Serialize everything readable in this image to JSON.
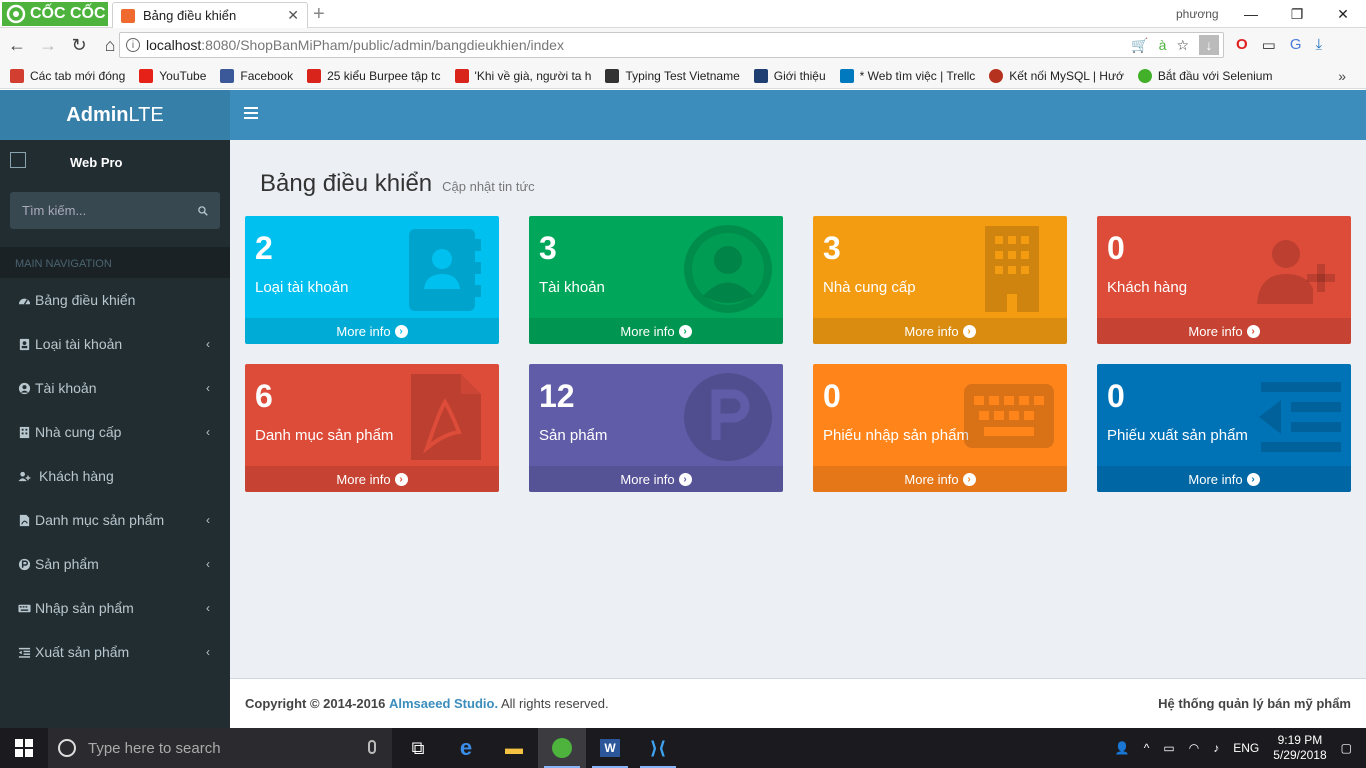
{
  "browser": {
    "brand": "CỐC CỐC",
    "tab_title": "Bảng điều khiển",
    "profile": "phương",
    "url_host": "localhost",
    "url_path": ":8080/ShopBanMiPham/public/admin/bangdieukhien/index",
    "bookmarks": [
      {
        "label": "Các tab mới đóng",
        "color": "#d23f31"
      },
      {
        "label": "YouTube",
        "color": "#e62117"
      },
      {
        "label": "Facebook",
        "color": "#3b5998"
      },
      {
        "label": "25 kiểu Burpee tập tc",
        "color": "#d9241b"
      },
      {
        "label": "'Khi về già, người ta h",
        "color": "#d9241b"
      },
      {
        "label": "Typing Test Vietname",
        "color": "#333333"
      },
      {
        "label": "Giới thiệu",
        "color": "#1f3f73"
      },
      {
        "label": "* Web tìm việc | Trellc",
        "color": "#0079bf"
      },
      {
        "label": "Kết nối MySQL | Hướ",
        "color": "#b5321e"
      },
      {
        "label": "Bắt đầu với Selenium",
        "color": "#43b02a"
      }
    ]
  },
  "admin": {
    "logo_bold": "Admin",
    "logo_light": "LTE",
    "user_name": "Web Pro",
    "user_img_alt": "User Image",
    "search_placeholder": "Tìm kiếm...",
    "nav_header": "MAIN NAVIGATION",
    "menu": [
      {
        "label": "Bảng điều khiển",
        "icon": "dashboard-icon",
        "caret": ""
      },
      {
        "label": "Loại tài khoản",
        "icon": "contact-card-icon",
        "caret": "‹"
      },
      {
        "label": "Tài khoản",
        "icon": "user-circle-icon",
        "caret": "‹"
      },
      {
        "label": "Nhà cung cấp",
        "icon": "building-icon",
        "caret": "‹"
      },
      {
        "label": "Khách hàng",
        "icon": "user-plus-icon",
        "caret": ""
      },
      {
        "label": "Danh mục sản phẩm",
        "icon": "pdf-file-icon",
        "caret": "‹"
      },
      {
        "label": "Sản phẩm",
        "icon": "product-p-icon",
        "caret": "‹"
      },
      {
        "label": "Nhập sản phẩm",
        "icon": "keyboard-icon",
        "caret": "‹"
      },
      {
        "label": "Xuất sản phẩm",
        "icon": "outdent-icon",
        "caret": "‹"
      }
    ]
  },
  "page": {
    "title": "Bảng điều khiển",
    "subtitle": "Cập nhật tin tức",
    "more_info": "More info",
    "boxes": [
      {
        "count": "2",
        "label": "Loại tài khoản",
        "color": "#00c0ef",
        "icon": "contact-book-icon"
      },
      {
        "count": "3",
        "label": "Tài khoản",
        "color": "#00a65a",
        "icon": "user-circle-icon"
      },
      {
        "count": "3",
        "label": "Nhà cung cấp",
        "color": "#f39c12",
        "icon": "building-icon"
      },
      {
        "count": "0",
        "label": "Khách hàng",
        "color": "#dd4b39",
        "icon": "user-plus-icon"
      },
      {
        "count": "6",
        "label": "Danh mục sản phẩm",
        "color": "#dd4b39",
        "icon": "pdf-file-icon"
      },
      {
        "count": "12",
        "label": "Sản phẩm",
        "color": "#605ca8",
        "icon": "product-p-icon"
      },
      {
        "count": "0",
        "label": "Phiếu nhập sản phẩm",
        "color": "#ff851b",
        "icon": "keyboard-icon"
      },
      {
        "count": "0",
        "label": "Phiếu xuất sản phẩm",
        "color": "#0073b7",
        "icon": "outdent-icon"
      }
    ]
  },
  "footer": {
    "copyright_prefix": "Copyright © 2014-2016",
    "copyright_brand": "Almsaeed Studio.",
    "copyright_suffix": "All rights reserved.",
    "right": "Hệ thống quản lý bán mỹ phẩm"
  },
  "taskbar": {
    "search_placeholder": "Type here to search",
    "lang": "ENG",
    "time": "9:19 PM",
    "date": "5/29/2018"
  }
}
